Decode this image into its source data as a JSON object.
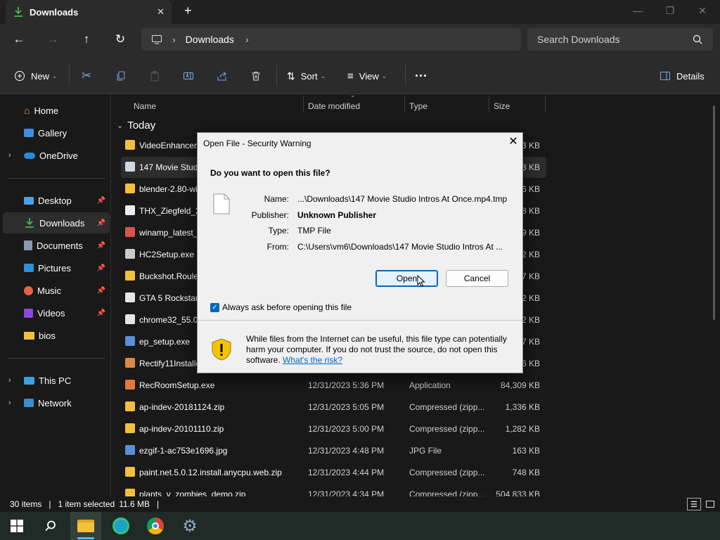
{
  "window": {
    "tab_title": "Downloads",
    "new_tab": "+",
    "minimize": "—",
    "restore": "❐",
    "close": "✕"
  },
  "address": {
    "crumbs": [
      "Downloads"
    ],
    "search_placeholder": "Search Downloads"
  },
  "toolbar": {
    "new_label": "New",
    "sort_label": "Sort",
    "view_label": "View",
    "more_label": "···",
    "details_label": "Details"
  },
  "sidebar": {
    "top": [
      {
        "label": "Home"
      },
      {
        "label": "Gallery"
      },
      {
        "label": "OneDrive"
      }
    ],
    "pinned": [
      {
        "label": "Desktop"
      },
      {
        "label": "Downloads"
      },
      {
        "label": "Documents"
      },
      {
        "label": "Pictures"
      },
      {
        "label": "Music"
      },
      {
        "label": "Videos"
      },
      {
        "label": "bios"
      }
    ],
    "bottom": [
      {
        "label": "This PC"
      },
      {
        "label": "Network"
      }
    ]
  },
  "columns": {
    "name": "Name",
    "date": "Date modified",
    "type": "Type",
    "size": "Size"
  },
  "group_label": "Today",
  "files": [
    {
      "name": "VideoEnhancerI",
      "date": "",
      "type": "",
      "size": "3 KB"
    },
    {
      "name": "147 Movie Stud",
      "date": "",
      "type": "",
      "size": "3 KB"
    },
    {
      "name": "blender-2.80-wi",
      "date": "",
      "type": "",
      "size": "6 KB"
    },
    {
      "name": "THX_Ziegfeld_2",
      "date": "",
      "type": "",
      "size": "8 KB"
    },
    {
      "name": "winamp_latest_",
      "date": "",
      "type": "",
      "size": "9 KB"
    },
    {
      "name": "HC2Setup.exe",
      "date": "",
      "type": "",
      "size": "2 KB"
    },
    {
      "name": "Buckshot.Roule",
      "date": "",
      "type": "",
      "size": "7 KB"
    },
    {
      "name": "GTA 5 Rockstar",
      "date": "",
      "type": "",
      "size": "2 KB"
    },
    {
      "name": "chrome32_55.0.",
      "date": "",
      "type": "",
      "size": "2 KB"
    },
    {
      "name": "ep_setup.exe",
      "date": "",
      "type": "",
      "size": "7 KB"
    },
    {
      "name": "Rectify11Installe",
      "date": "",
      "type": "",
      "size": "6 KB"
    },
    {
      "name": "RecRoomSetup.exe",
      "date": "12/31/2023 5:36 PM",
      "type": "Application",
      "size": "84,309 KB"
    },
    {
      "name": "ap-indev-20181124.zip",
      "date": "12/31/2023 5:05 PM",
      "type": "Compressed (zipp...",
      "size": "1,336 KB"
    },
    {
      "name": "ap-indev-20101110.zip",
      "date": "12/31/2023 5:00 PM",
      "type": "Compressed (zipp...",
      "size": "1,282 KB"
    },
    {
      "name": "ezgif-1-ac753e1696.jpg",
      "date": "12/31/2023 4:48 PM",
      "type": "JPG File",
      "size": "163 KB"
    },
    {
      "name": "paint.net.5.0.12.install.anycpu.web.zip",
      "date": "12/31/2023 4:44 PM",
      "type": "Compressed (zipp...",
      "size": "748 KB"
    },
    {
      "name": "plants_v_zombies_demo.zip",
      "date": "12/31/2023 4:34 PM",
      "type": "Compressed (zipp...",
      "size": "504,833 KB"
    }
  ],
  "status": {
    "items": "30 items",
    "selected": "1 item selected",
    "size": "11.6 MB"
  },
  "dialog": {
    "title": "Open File - Security Warning",
    "question": "Do you want to open this file?",
    "labels": {
      "name": "Name:",
      "publisher": "Publisher:",
      "type": "Type:",
      "from": "From:"
    },
    "values": {
      "name": "...\\Downloads\\147 Movie Studio Intros At Once.mp4.tmp",
      "publisher": "Unknown Publisher",
      "type": "TMP File",
      "from": "C:\\Users\\vm6\\Downloads\\147 Movie Studio Intros At ..."
    },
    "open_button": "Open",
    "cancel_button": "Cancel",
    "checkbox_label": "Always ask before opening this file",
    "checkbox_checked": true,
    "warning_text": "While files from the Internet can be useful, this file type can potentially harm your computer. If you do not trust the source, do not open this software.",
    "risk_link": "What's the risk?"
  },
  "colors": {
    "accent": "#0067c0",
    "selection": "#2d2d2d",
    "shield": "#f5c400",
    "taskbar": "#202a26"
  }
}
